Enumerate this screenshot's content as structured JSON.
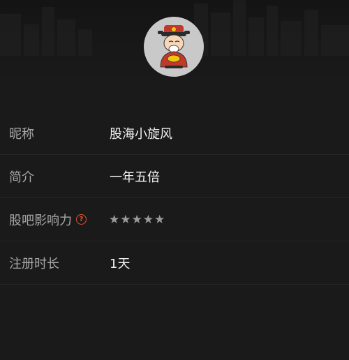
{
  "profile": {
    "avatar_icon": "god-of-wealth-avatar-icon"
  },
  "info": {
    "nickname": {
      "label": "昵称",
      "value": "股海小旋风"
    },
    "intro": {
      "label": "简介",
      "value": "一年五倍"
    },
    "influence": {
      "label": "股吧影响力",
      "help_icon": "?",
      "stars": "★★★★★",
      "rating": 0,
      "max_rating": 5
    },
    "registered": {
      "label": "注册时长",
      "value": "1天"
    }
  },
  "colors": {
    "background": "#1a1a1a",
    "label": "#a7a7a7",
    "value": "#f2f2f2",
    "help_accent": "#e2532e",
    "star_empty": "#9a9a9a"
  }
}
